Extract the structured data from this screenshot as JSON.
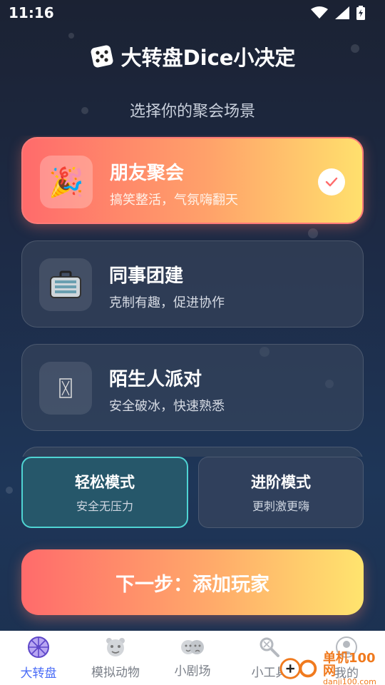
{
  "status": {
    "time": "11:16"
  },
  "header": {
    "title": "大转盘Dice小决定",
    "icon": "dice-icon"
  },
  "subtitle": "选择你的聚会场景",
  "scenes": [
    {
      "title": "朋友聚会",
      "desc": "搞笑整活，气氛嗨翻天",
      "icon": "party-popper-icon",
      "glyph": "🎉",
      "selected": true
    },
    {
      "title": "同事团建",
      "desc": "克制有趣，促进协作",
      "icon": "briefcase-icon",
      "glyph": "💼",
      "selected": false
    },
    {
      "title": "陌生人派对",
      "desc": "安全破冰，快速熟悉",
      "icon": "hourglass-icon",
      "glyph": "⌛",
      "selected": false
    }
  ],
  "modes": [
    {
      "title": "轻松模式",
      "desc": "安全无压力",
      "active": true
    },
    {
      "title": "进阶模式",
      "desc": "更刺激更嗨",
      "active": false
    }
  ],
  "next_button": "下一步：添加玩家",
  "tabs": [
    {
      "label": "大转盘",
      "icon": "wheel-icon",
      "active": true
    },
    {
      "label": "模拟动物",
      "icon": "animal-face-icon",
      "active": false
    },
    {
      "label": "小剧场",
      "icon": "theater-masks-icon",
      "active": false
    },
    {
      "label": "小工具",
      "icon": "tools-icon",
      "active": false
    },
    {
      "label": "我的",
      "icon": "profile-icon",
      "active": false
    }
  ],
  "watermark": {
    "big": "单机100网",
    "small": "danji100.com"
  },
  "colors": {
    "accent": "#4a6cf7",
    "selected_gradient_start": "#ff6b6b",
    "selected_gradient_end": "#ffe06d",
    "mode_active": "#4fd4d3"
  }
}
